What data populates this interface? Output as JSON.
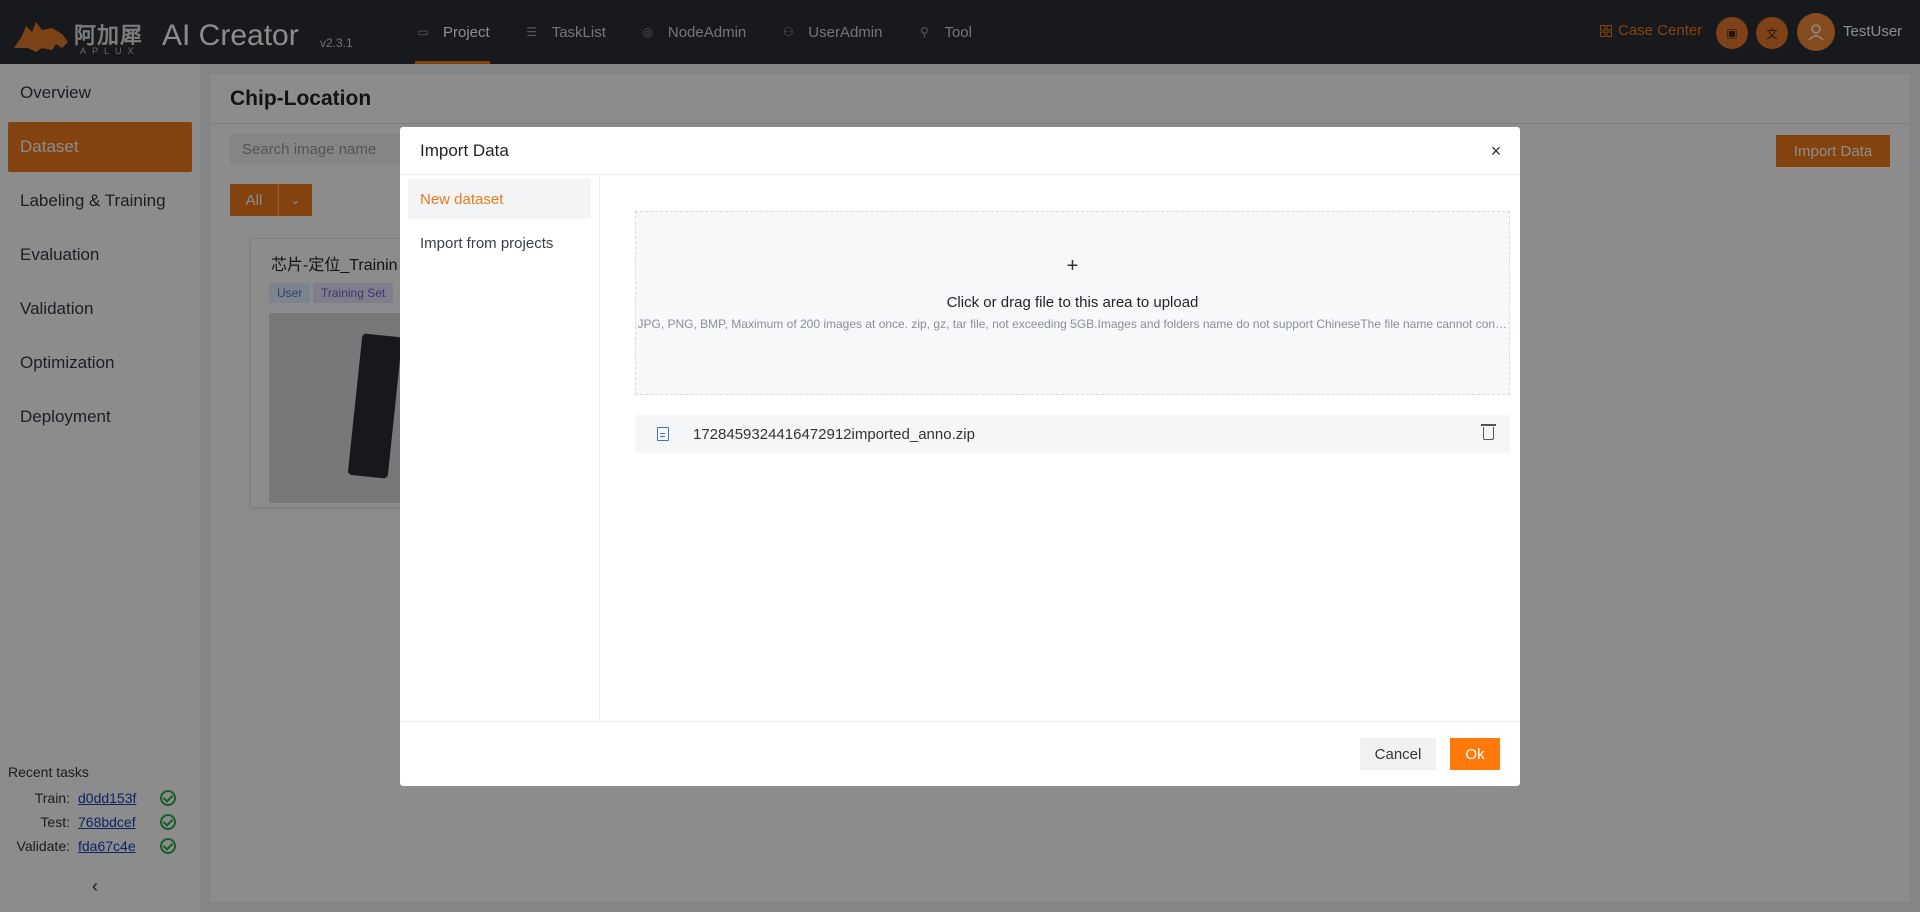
{
  "header": {
    "logo_cn": "阿加犀",
    "logo_en": "APLUX",
    "app_title": "AI Creator",
    "version": "v2.3.1",
    "nav": [
      {
        "label": "Project",
        "icon": "folder-icon",
        "active": true
      },
      {
        "label": "TaskList",
        "icon": "list-icon"
      },
      {
        "label": "NodeAdmin",
        "icon": "node-icon"
      },
      {
        "label": "UserAdmin",
        "icon": "users-icon"
      },
      {
        "label": "Tool",
        "icon": "wrench-icon"
      }
    ],
    "case_center": "Case Center",
    "username": "TestUser",
    "accent_color": "#f07a1a"
  },
  "sidebar": {
    "items": [
      {
        "label": "Overview"
      },
      {
        "label": "Dataset",
        "active": true
      },
      {
        "label": "Labeling & Training"
      },
      {
        "label": "Evaluation"
      },
      {
        "label": "Validation"
      },
      {
        "label": "Optimization"
      },
      {
        "label": "Deployment"
      }
    ],
    "recent_title": "Recent tasks",
    "recent": [
      {
        "label": "Train:",
        "id": "d0dd153f",
        "status": "success"
      },
      {
        "label": "Test:",
        "id": "768bdcef",
        "status": "success"
      },
      {
        "label": "Validate:",
        "id": "fda67c4e",
        "status": "success"
      }
    ],
    "collapse_glyph": "‹"
  },
  "main": {
    "title": "Chip-Location",
    "search_placeholder": "Search image name",
    "import_button": "Import Data",
    "filter_value": "All",
    "card": {
      "title": "芯片-定位_Trainin",
      "tags": [
        "User",
        "Training Set"
      ]
    }
  },
  "modal": {
    "title": "Import Data",
    "close_glyph": "×",
    "tabs": [
      {
        "label": "New dataset",
        "active": true
      },
      {
        "label": "Import from projects"
      }
    ],
    "upload": {
      "plus": "+",
      "text": "Click or drag file to this area to upload",
      "hint": "JPG, PNG, BMP, Maximum of 200 images at once. zip, gz, tar file, not exceeding 5GB.Images and folders name do not support ChineseThe file name cannot contain special characters"
    },
    "file": {
      "name": "1728459324416472912imported_anno.zip"
    },
    "cancel": "Cancel",
    "ok": "Ok"
  }
}
